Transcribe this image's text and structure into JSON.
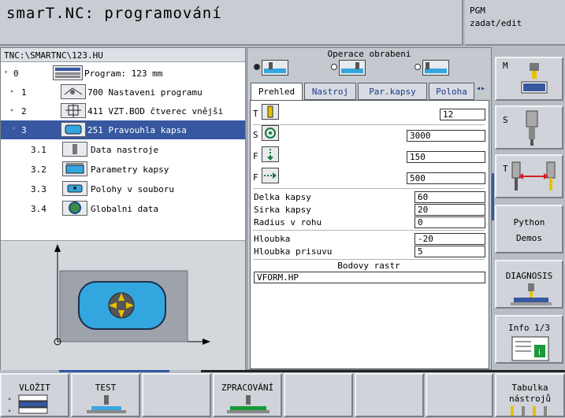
{
  "title": "smarT.NC: programování",
  "mode": {
    "line1": "PGM",
    "line2": "zadat/edit"
  },
  "path": "TNC:\\SMARTNC\\123.HU",
  "tree": [
    {
      "exp": "▿",
      "num": "0",
      "label": "Program: 123 mm",
      "icon": "program-icon"
    },
    {
      "exp": "▹",
      "num": "1",
      "label": "700 Nastaveni programu",
      "icon": "settings-icon"
    },
    {
      "exp": "▹",
      "num": "2",
      "label": "411 VZT.BOD čtverec vnějši",
      "icon": "datum-icon"
    },
    {
      "exp": "◦",
      "num": "3",
      "label": "251 Pravouhla kapsa",
      "icon": "pocket-icon"
    },
    {
      "exp": "",
      "num": "3.1",
      "label": "Data nastroje",
      "icon": "tool-data-icon"
    },
    {
      "exp": "",
      "num": "3.2",
      "label": "Parametry kapsy",
      "icon": "pocket-params-icon"
    },
    {
      "exp": "",
      "num": "3.3",
      "label": "Polohy v souboru",
      "icon": "positions-icon"
    },
    {
      "exp": "",
      "num": "3.4",
      "label": "Globalni data",
      "icon": "global-data-icon"
    }
  ],
  "operation": {
    "title": "Operace obrabeni"
  },
  "tabs": [
    "Prehled",
    "Nastroj",
    "Par.kapsy",
    "Poloha"
  ],
  "form": {
    "t_value": "12",
    "s_value": "3000",
    "f1_value": "150",
    "f2_value": "500",
    "params": [
      {
        "label": "Delka kapsy",
        "value": "60"
      },
      {
        "label": "Sirka kapsy",
        "value": "20"
      },
      {
        "label": "Radius v rohu",
        "value": "0"
      },
      {
        "label": "Hloubka",
        "value": "-20"
      },
      {
        "label": "Hloubka prisuvu",
        "value": "5"
      }
    ],
    "raster_title": "Bodovy rastr",
    "raster_value": "VFORM.HP"
  },
  "letters": {
    "t": "T",
    "s": "S",
    "f": "F"
  },
  "softkeys_right": [
    {
      "label": "M"
    },
    {
      "label": "S"
    },
    {
      "label": "T"
    },
    {
      "label": "Python",
      "label2": "Demos"
    },
    {
      "label": "DIAGNOSIS"
    },
    {
      "label": "Info 1/3"
    }
  ],
  "softkeys_bottom": [
    {
      "label": "VLOŽIT"
    },
    {
      "label": "TEST"
    },
    {
      "label": ""
    },
    {
      "label": "ZPRACOVÁNÍ"
    },
    {
      "label": ""
    },
    {
      "label": ""
    },
    {
      "label": ""
    },
    {
      "label": "Tabulka",
      "label2": "nástrojů"
    }
  ],
  "colors": {
    "selection": "#3758a0",
    "tab_text": "#1a3a8c",
    "pocket_blue": "#33a6e0"
  }
}
